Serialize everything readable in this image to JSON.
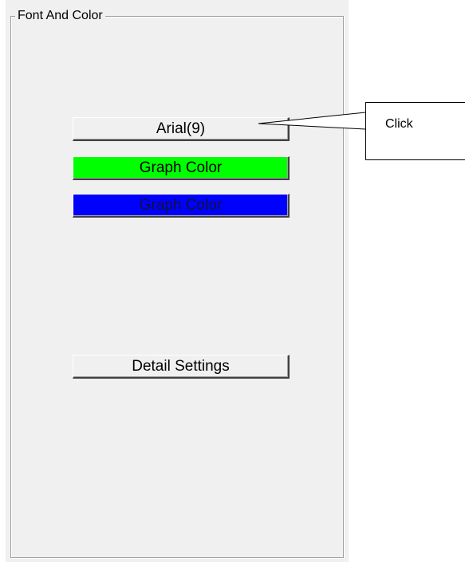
{
  "groupbox": {
    "title": "Font And Color"
  },
  "buttons": {
    "font": "Arial(9)",
    "graph_color_1": "Graph Color",
    "graph_color_2": "Graph Color",
    "detail_settings": "Detail Settings"
  },
  "colors": {
    "graph_color_1": "#00ff00",
    "graph_color_2": "#0000ff"
  },
  "callout": {
    "text": "Click"
  }
}
